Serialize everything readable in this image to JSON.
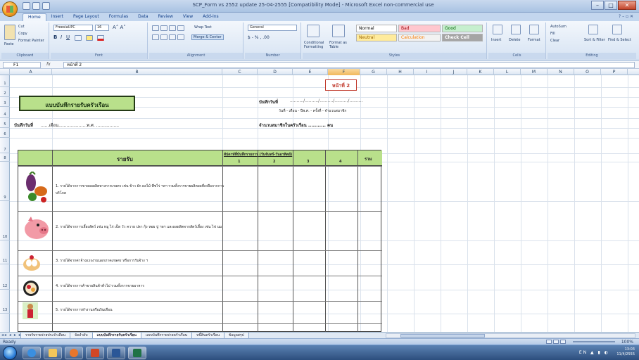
{
  "window": {
    "title": "SCP_Form vs 2552 update 25-04-2555 [Compatibility Mode] - Microsoft Excel non-commercial use"
  },
  "ribbon_tabs": [
    "Home",
    "Insert",
    "Page Layout",
    "Formulas",
    "Data",
    "Review",
    "View",
    "Add-Ins"
  ],
  "ribbon": {
    "clipboard": {
      "paste": "Paste",
      "cut": "Cut",
      "copy": "Copy",
      "format_painter": "Format Painter",
      "label": "Clipboard"
    },
    "font": {
      "name": "FreesiaUPC",
      "size": "16",
      "label": "Font"
    },
    "alignment": {
      "wrap_text": "Wrap Text",
      "merge_center": "Merge & Center",
      "label": "Alignment"
    },
    "number": {
      "format": "General",
      "label": "Number"
    },
    "styles": {
      "conditional": "Conditional Formatting",
      "format_table": "Format as Table",
      "normal": "Normal",
      "bad": "Bad",
      "good": "Good",
      "neutral": "Neutral",
      "calculation": "Calculation",
      "check_cell": "Check Cell",
      "label": "Styles"
    },
    "cells": {
      "insert": "Insert",
      "delete": "Delete",
      "format": "Format",
      "label": "Cells"
    },
    "editing": {
      "autosum": "AutoSum",
      "fill": "Fill",
      "clear": "Clear",
      "sort_filter": "Sort & Filter",
      "find_select": "Find & Select",
      "label": "Editing"
    }
  },
  "formula_bar": {
    "name_box": "F1",
    "fx": "fx",
    "formula": "หน้าที่ 2"
  },
  "columns": [
    "A",
    "B",
    "C",
    "D",
    "E",
    "F",
    "G",
    "H",
    "I",
    "J",
    "K",
    "L",
    "M",
    "N",
    "O",
    "P",
    "Q"
  ],
  "rows": [
    "1",
    "2",
    "3",
    "4",
    "5",
    "6",
    "7",
    "8",
    "9",
    "10",
    "11",
    "12",
    "13"
  ],
  "sheet": {
    "page_label": "หน้าที่ 2",
    "form_title": "แบบบันทึกรายรับครัวเรือน",
    "record_date_label": "บันทึกวันที่",
    "record_date_line": "......เดือน.....................พ.ศ. .................",
    "record_label": "บันทึกวันที่",
    "date_format": "วันที่ - เดือน - ปีพ.ศ. - ครั้งที่ - จำนวนสมาชิก",
    "household_count": "จำนวนสมาชิกในครัวเรือน ........... คน",
    "income_header": "รายรับ",
    "weekly_header": "สัปดาห์ที่บันทึกรายการ (วันจันทร์-วันอาทิตย์)",
    "week_nums": [
      "1",
      "2",
      "3",
      "4"
    ],
    "total_header": "รวม",
    "items": [
      "1. รายได้จากการขายผลผลิตทางการเกษตร เช่น ข้าว ผัก ผลไม้ พืชไร่ ฯลฯ รวมทั้งการขายผลิตผลที่เหลือจากการบริโภค",
      "2. รายได้จากการเลี้ยงสัตว์ เช่น หมู ไก่ เป็ด วัว ควาย ปลา กุ้ง หอย ปู ฯลฯ และผลผลิตจากสัตว์เลี้ยง เช่น ไข่ นม",
      "3. รายได้จากค่าจ้างแรงงานนอกภาคเกษตร หรือการรับจ้าง ฯ",
      "4. รายได้จากการค้าขายสินค้าทั่วไป รวมทั้งการขายอาหาร",
      "5. รายได้จากการทำงานหรือเงินเดือน"
    ]
  },
  "sheet_tabs": [
    "รายรับรายจ่ายประจำเดือน",
    "จัดลำดับ",
    "แบบบันทึกรายรับครัวเรือน",
    "แบบบันทึกรายจ่ายครัวเรือน",
    "หนี้สินครัวเรือน",
    "ข้อมูลสรุป"
  ],
  "status": {
    "text": "Ready",
    "zoom": "100%"
  },
  "tray": {
    "lang": "EN",
    "time": "13:03",
    "date": "11/4/2555"
  }
}
